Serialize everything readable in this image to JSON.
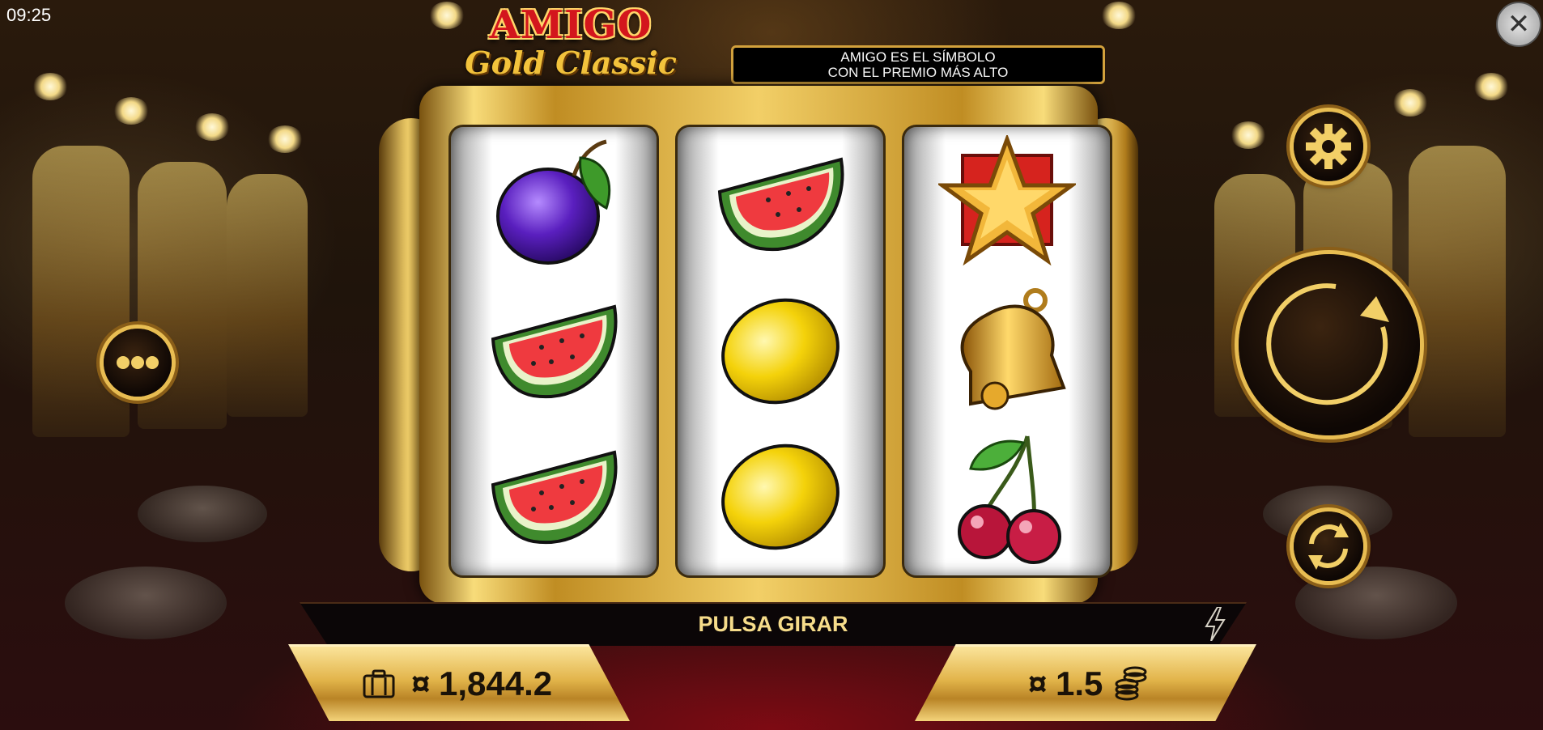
{
  "status": {
    "time": "09:25"
  },
  "logo": {
    "line1": "AMIGO",
    "line2": "Gold Classic"
  },
  "info_banner": {
    "line1": "AMIGO ES EL SÍMBOLO",
    "line2": "CON EL PREMIO MÁS ALTO"
  },
  "reels": [
    [
      "plum",
      "watermelon",
      "watermelon"
    ],
    [
      "watermelon",
      "lemon",
      "lemon"
    ],
    [
      "star",
      "bell",
      "cherries"
    ]
  ],
  "message": "PULSA GIRAR",
  "balance": {
    "icon": "briefcase-icon",
    "currency": "¤",
    "value": "1,844.2"
  },
  "bet": {
    "icon": "coins-icon",
    "currency": "¤",
    "value": "1.5"
  },
  "buttons": {
    "close": "close-icon",
    "menu": "more-dots-icon",
    "settings": "gear-icon",
    "spin": "spin-arrow-icon",
    "autoplay": "autoplay-icon",
    "turbo": "lightning-icon"
  },
  "colors": {
    "gold": "#e8bd52",
    "message": "#f6dc8a",
    "logo_red": "#d3161d"
  }
}
